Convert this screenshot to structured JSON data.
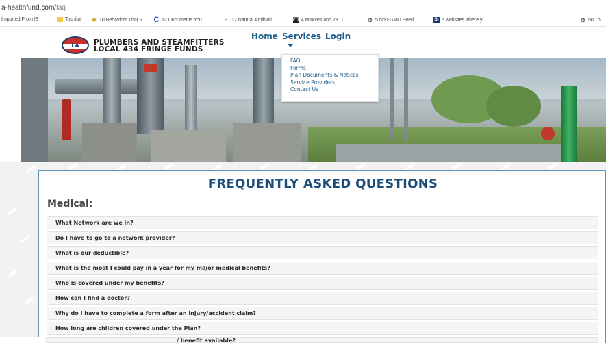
{
  "browser": {
    "url_prefix": "a-healthfund.com/",
    "url_path": "faq",
    "bookmarks": [
      {
        "label": "Imported From IE",
        "icon": "folder-icon"
      },
      {
        "label": "Toshiba",
        "icon": "folder-icon"
      },
      {
        "label": "10 Behaviors That R...",
        "icon": "site-icon"
      },
      {
        "label": "12 Documents You...",
        "icon": "site-c-icon"
      },
      {
        "label": "12 Natural Antibioti...",
        "icon": "site-icon"
      },
      {
        "label": "4 Minutes and 28 D...",
        "icon": "site-fit-icon"
      },
      {
        "label": "5 Non-GMO Seed...",
        "icon": "site-icon"
      },
      {
        "label": "5 websites where y...",
        "icon": "site-bi-icon"
      },
      {
        "label": "50 Thi",
        "icon": "site-icon"
      }
    ]
  },
  "header": {
    "logo_text": "LA",
    "brand_line1": "PLUMBERS AND STEAMFITTERS",
    "brand_line2": "LOCAL 434 FRINGE FUNDS",
    "nav": {
      "home": "Home",
      "services": "Services",
      "login": "Login"
    }
  },
  "services_menu": {
    "items": [
      "FAQ",
      "Forms",
      "Plan Documents & Notices",
      "Service Providers",
      "Contact Us"
    ]
  },
  "faq": {
    "title": "FREQUENTLY ASKED QUESTIONS",
    "section": "Medical:",
    "questions": [
      "What Network are we in?",
      "Do I have to go to a network provider?",
      "What is our deductible?",
      "What is the most I could pay in a year for my major medical benefits?",
      "Who is covered under my benefits?",
      "How can I find a doctor?",
      "Why do I have to complete a form after an injury/accident claim?",
      "How long are children covered under the Plan?"
    ],
    "partial_question": "/ benefit available?"
  },
  "colors": {
    "nav": "#1c5c8a",
    "title": "#1c4e7a",
    "panel_border": "#5d95b8",
    "logo_red": "#c9302c"
  }
}
